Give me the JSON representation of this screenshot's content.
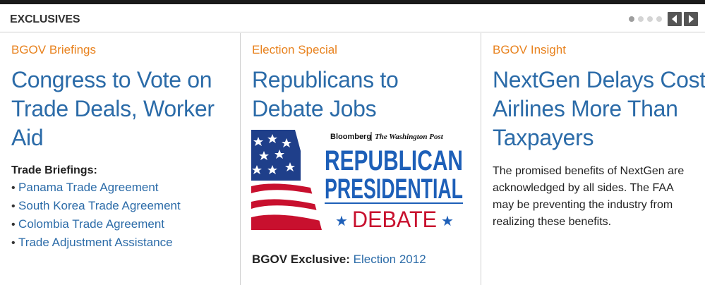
{
  "header": {
    "title": "EXCLUSIVES"
  },
  "pager": {
    "dots": 4,
    "active_index": 0,
    "prev_icon": "chevron-left-icon",
    "next_icon": "chevron-right-icon"
  },
  "colors": {
    "kicker": "#e8821e",
    "link": "#2b6ba8",
    "flag_red": "#c8102e",
    "flag_blue": "#1f3f8a",
    "debate_blue": "#1d5fb8"
  },
  "columns": [
    {
      "kicker": "BGOV Briefings",
      "headline": "Congress to Vote on Trade Deals, Worker Aid",
      "briefings_label": "Trade Briefings:",
      "briefings": [
        "Panama Trade Agreement",
        "South Korea Trade Agreement",
        "Colombia Trade Agreement",
        "Trade Adjustment Assistance"
      ]
    },
    {
      "kicker": "Election Special",
      "headline": "Republicans to Debate Jobs",
      "graphic": {
        "brand_left": "Bloomberg",
        "brand_right": "The Washington Post",
        "line1": "REPUBLICAN",
        "line2": "PRESIDENTIAL",
        "line3": "DEBATE"
      },
      "exclusive_label": "BGOV Exclusive:",
      "exclusive_link": "Election 2012"
    },
    {
      "kicker": "BGOV Insight",
      "headline": "NextGen Delays Cost Airlines More Than Taxpayers",
      "summary": "The promised benefits of NextGen are acknowledged by all sides. The FAA may be preventing the industry from realizing these benefits."
    }
  ]
}
